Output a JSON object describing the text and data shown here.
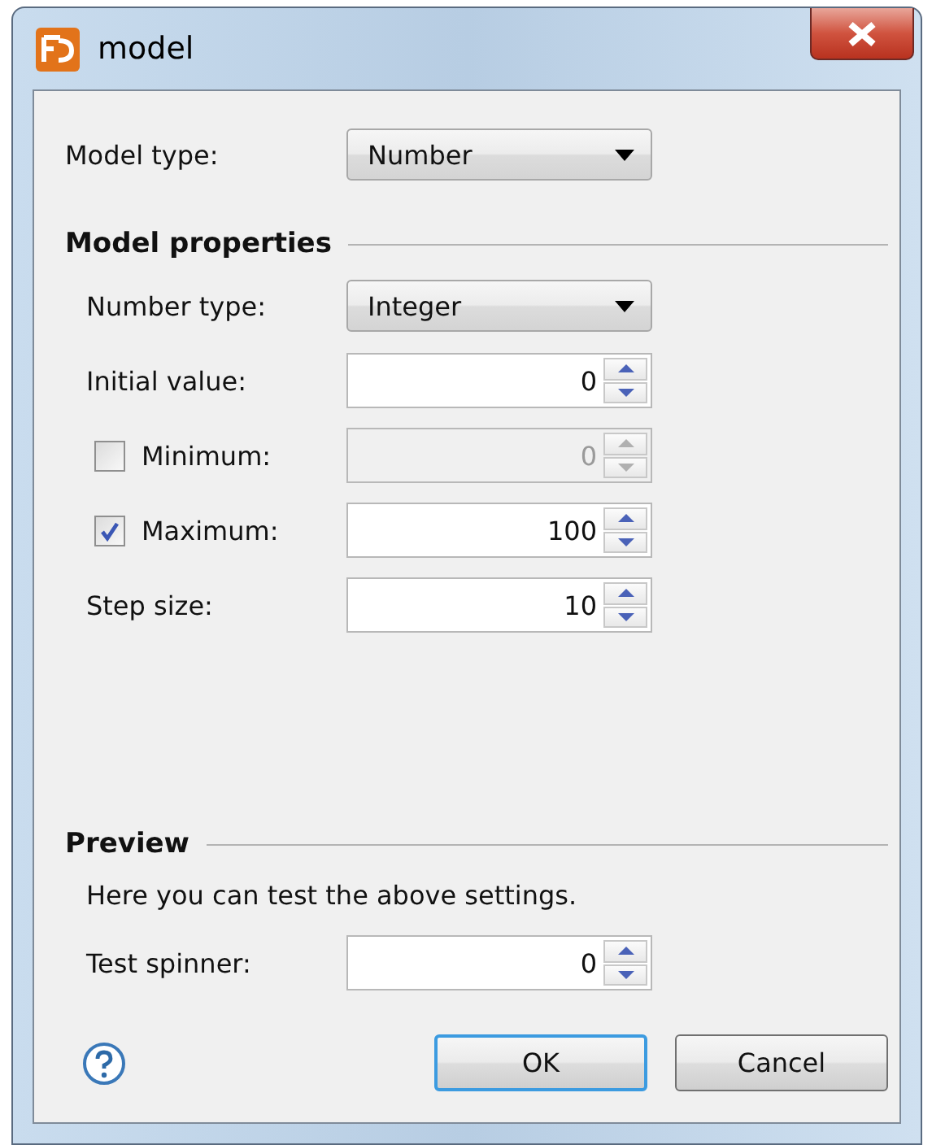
{
  "window": {
    "title": "model"
  },
  "model_type": {
    "label": "Model type:",
    "value": "Number"
  },
  "model_properties": {
    "heading": "Model properties",
    "rows": [
      {
        "kind": "combo",
        "label": "Number type:",
        "value": "Integer"
      },
      {
        "kind": "spinner",
        "label": "Initial value:",
        "value": "0"
      },
      {
        "kind": "check-spinner",
        "label": "Minimum:",
        "checked": false,
        "value": "0"
      },
      {
        "kind": "check-spinner",
        "label": "Maximum:",
        "checked": true,
        "value": "100"
      },
      {
        "kind": "spinner",
        "label": "Step size:",
        "value": "10"
      }
    ]
  },
  "preview": {
    "heading": "Preview",
    "description": "Here you can test the above settings.",
    "spinner": {
      "label": "Test spinner:",
      "value": "0"
    }
  },
  "buttons": [
    {
      "label": "OK",
      "default": true
    },
    {
      "label": "Cancel",
      "default": false
    }
  ]
}
